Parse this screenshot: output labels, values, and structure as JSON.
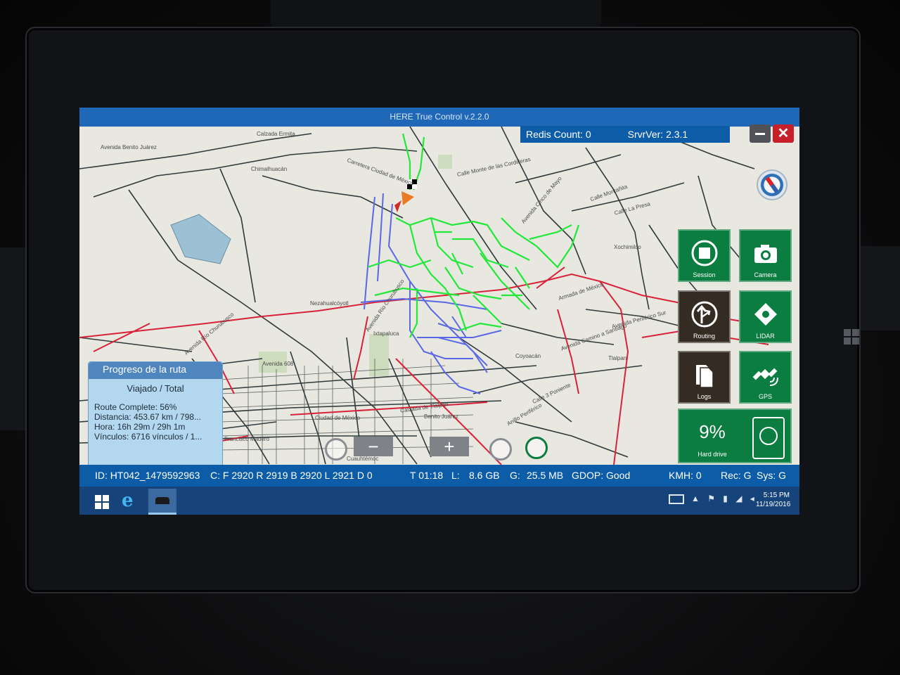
{
  "app": {
    "title": "HERE True Control v.2.2.0"
  },
  "header": {
    "redis_count": "Redis Count: 0",
    "server_version": "SrvrVer: 2.3.1"
  },
  "window_controls": {
    "close_label": "✕"
  },
  "map": {
    "labels": [
      "Calzada Ermita",
      "Avenida Benito Juárez",
      "Chimalhuacán",
      "Carretera Ciudad de México",
      "Calle Monte de las Cordilleras",
      "Avenida Cinco de Mayo",
      "Calle Montañita",
      "Calle La Presa",
      "Xochimilco",
      "Nezahualcóyotl",
      "Armada de México",
      "Avenida Periférico Sur",
      "Avenida Camino a Santiago",
      "Tlalpan",
      "Avenida 608",
      "Avenida Río Churubusco",
      "Avenida Río Churubusco",
      "Ixtapaluca",
      "Calzada de Tlalpan",
      "Anillo Periférico",
      "Calle 3 Poniente",
      "Coyoacán",
      "Ciudad de México",
      "Benito Juárez",
      "Cuauhtémoc",
      "Francisco Madero"
    ]
  },
  "side_panel": {
    "tiles": [
      {
        "label": "Session",
        "icon": "session-stop-icon"
      },
      {
        "label": "Camera",
        "icon": "camera-icon"
      },
      {
        "label": "Routing",
        "icon": "routing-arrow-icon"
      },
      {
        "label": "LIDAR",
        "icon": "lidar-icon"
      },
      {
        "label": "Logs",
        "icon": "logs-icon"
      },
      {
        "label": "GPS",
        "icon": "satellite-icon"
      }
    ],
    "hard_drive": {
      "percent": "9%",
      "label": "Hard drive"
    }
  },
  "progress": {
    "header": "Progreso de la ruta",
    "subheader": "Viajado / Total",
    "route_complete": "Route Complete: 56%",
    "distance": "Distancia: 453.67 km / 798...",
    "time": "Hora: 16h 29m / 29h 1m",
    "links": "Vínculos: 6716 vínculos / 1..."
  },
  "status_bar": {
    "id": "ID: HT042_1479592963",
    "counters": "C: F 2920 R 2919 B 2920 L 2921 D 0",
    "t": "T 01:18",
    "l_label": "L:",
    "l_value": "8.6 GB",
    "g_label": "G:",
    "g_value": "25.5 MB",
    "gdop": "GDOP: Good",
    "kmh": "KMH: 0",
    "rec": "Rec: G",
    "sys": "Sys: G"
  },
  "taskbar": {
    "time": "5:15 PM",
    "date": "11/19/2016"
  },
  "colors": {
    "accent_blue": "#0d5ca8",
    "tile_green": "#0b7d40",
    "tile_dark": "#342b23",
    "route_green": "#22e83a",
    "route_blue": "#5a68e6",
    "road_red": "#d8223a"
  }
}
